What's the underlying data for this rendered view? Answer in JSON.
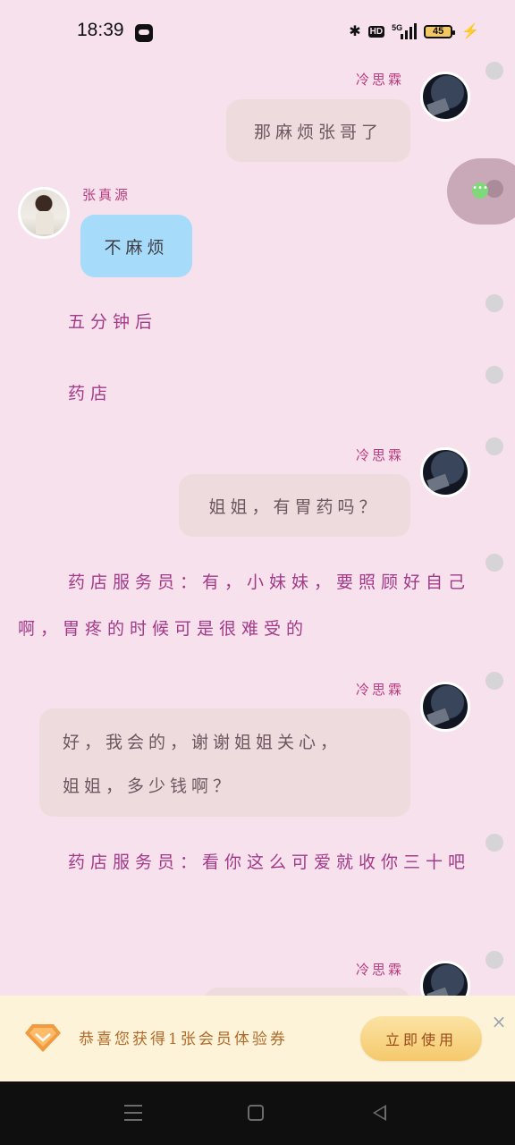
{
  "status_bar": {
    "time": "18:39",
    "hd": "HD",
    "network": "5G",
    "battery": "45",
    "icons": [
      "app-icon",
      "bluetooth-icon",
      "hd-icon",
      "signal-icon",
      "battery-icon",
      "charging-icon"
    ]
  },
  "messages": {
    "m1": {
      "sender": "冷思霖",
      "text": "那麻烦张哥了"
    },
    "m2": {
      "sender": "张真源",
      "text": "不麻烦"
    },
    "n1": "五分钟后",
    "n2": "药店",
    "m3": {
      "sender": "冷思霖",
      "text": "姐姐，有胃药吗？"
    },
    "n3": "药店服务员：有，小妹妹，要照顾好自己啊，胃疼的时候可是很难受的",
    "m4": {
      "sender": "冷思霖",
      "line1": "好，我会的，谢谢姐姐关心，",
      "line2": "姐姐，多少钱啊？"
    },
    "n4": "药店服务员：看你这么可爱就收你三十吧",
    "m5": {
      "sender": "冷思霖"
    }
  },
  "promo": {
    "text": "恭喜您获得1张会员体验券",
    "button": "立即使用",
    "close": "×"
  },
  "colors": {
    "background": "#f7e1ec",
    "my_bubble": "#eedbdd",
    "other_bubble": "#a7dbfa",
    "narration": "#a23a88",
    "name": "#b83d80",
    "promo_bg": "#fdf3d8"
  }
}
